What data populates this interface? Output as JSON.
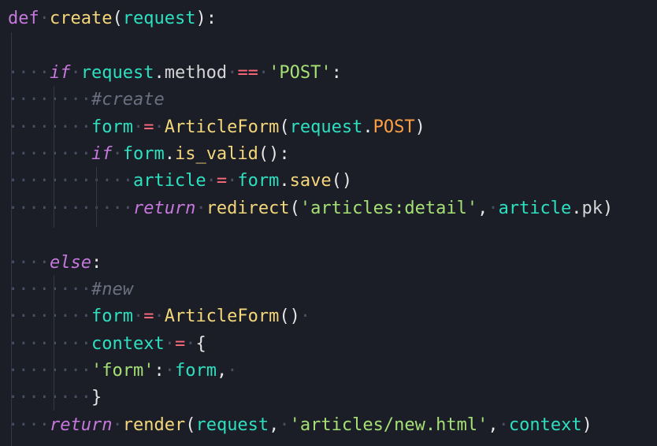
{
  "editor": {
    "theme": {
      "background": "#1b1d27",
      "whitespace": "#4a4f63",
      "default": "#d6d6d6",
      "keyword": "#c678dd",
      "keyword_italic": "#c678dd",
      "function": "#f3d77a",
      "variable": "#2ee0c0",
      "plain": "#d6d6d6",
      "operator": "#ff6b7a",
      "string": "#a5e075",
      "comment": "#6b7080",
      "constant": "#ff9f43",
      "punct": "#e6e6e6"
    },
    "lines": [
      [
        {
          "t": "def",
          "c": "keyword"
        },
        {
          "t": "·",
          "c": "ws"
        },
        {
          "t": "create",
          "c": "function"
        },
        {
          "t": "(",
          "c": "punct"
        },
        {
          "t": "request",
          "c": "variable"
        },
        {
          "t": "):",
          "c": "punct"
        }
      ],
      [],
      [
        {
          "t": "····",
          "c": "ws"
        },
        {
          "t": "if",
          "c": "keyword_italic"
        },
        {
          "t": "·",
          "c": "ws"
        },
        {
          "t": "request",
          "c": "variable"
        },
        {
          "t": ".",
          "c": "punct"
        },
        {
          "t": "method",
          "c": "plain"
        },
        {
          "t": "·",
          "c": "ws"
        },
        {
          "t": "==",
          "c": "operator"
        },
        {
          "t": "·",
          "c": "ws"
        },
        {
          "t": "'POST'",
          "c": "string"
        },
        {
          "t": ":",
          "c": "punct"
        }
      ],
      [
        {
          "t": "········",
          "c": "ws"
        },
        {
          "t": "#create",
          "c": "comment"
        }
      ],
      [
        {
          "t": "········",
          "c": "ws"
        },
        {
          "t": "form",
          "c": "variable"
        },
        {
          "t": "·",
          "c": "ws"
        },
        {
          "t": "=",
          "c": "operator"
        },
        {
          "t": "·",
          "c": "ws"
        },
        {
          "t": "ArticleForm",
          "c": "function"
        },
        {
          "t": "(",
          "c": "punct"
        },
        {
          "t": "request",
          "c": "variable"
        },
        {
          "t": ".",
          "c": "punct"
        },
        {
          "t": "POST",
          "c": "constant"
        },
        {
          "t": ")",
          "c": "punct"
        }
      ],
      [
        {
          "t": "········",
          "c": "ws"
        },
        {
          "t": "if",
          "c": "keyword_italic"
        },
        {
          "t": "·",
          "c": "ws"
        },
        {
          "t": "form",
          "c": "variable"
        },
        {
          "t": ".",
          "c": "punct"
        },
        {
          "t": "is_valid",
          "c": "function"
        },
        {
          "t": "():",
          "c": "punct"
        }
      ],
      [
        {
          "t": "············",
          "c": "ws"
        },
        {
          "t": "article",
          "c": "variable"
        },
        {
          "t": "·",
          "c": "ws"
        },
        {
          "t": "=",
          "c": "operator"
        },
        {
          "t": "·",
          "c": "ws"
        },
        {
          "t": "form",
          "c": "variable"
        },
        {
          "t": ".",
          "c": "punct"
        },
        {
          "t": "save",
          "c": "function"
        },
        {
          "t": "()",
          "c": "punct"
        }
      ],
      [
        {
          "t": "············",
          "c": "ws"
        },
        {
          "t": "return",
          "c": "keyword_italic"
        },
        {
          "t": "·",
          "c": "ws"
        },
        {
          "t": "redirect",
          "c": "function"
        },
        {
          "t": "(",
          "c": "punct"
        },
        {
          "t": "'articles:detail'",
          "c": "string"
        },
        {
          "t": ",",
          "c": "punct"
        },
        {
          "t": "·",
          "c": "ws"
        },
        {
          "t": "article",
          "c": "variable"
        },
        {
          "t": ".",
          "c": "punct"
        },
        {
          "t": "pk",
          "c": "plain"
        },
        {
          "t": ")",
          "c": "punct"
        }
      ],
      [],
      [
        {
          "t": "····",
          "c": "ws"
        },
        {
          "t": "else",
          "c": "keyword_italic"
        },
        {
          "t": ":",
          "c": "punct"
        }
      ],
      [
        {
          "t": "········",
          "c": "ws"
        },
        {
          "t": "#new",
          "c": "comment"
        }
      ],
      [
        {
          "t": "········",
          "c": "ws"
        },
        {
          "t": "form",
          "c": "variable"
        },
        {
          "t": "·",
          "c": "ws"
        },
        {
          "t": "=",
          "c": "operator"
        },
        {
          "t": "·",
          "c": "ws"
        },
        {
          "t": "ArticleForm",
          "c": "function"
        },
        {
          "t": "()",
          "c": "punct"
        },
        {
          "t": "·",
          "c": "ws"
        }
      ],
      [
        {
          "t": "········",
          "c": "ws"
        },
        {
          "t": "context",
          "c": "variable"
        },
        {
          "t": "·",
          "c": "ws"
        },
        {
          "t": "=",
          "c": "operator"
        },
        {
          "t": "·",
          "c": "ws"
        },
        {
          "t": "{",
          "c": "punct"
        }
      ],
      [
        {
          "t": "········",
          "c": "ws"
        },
        {
          "t": "'form'",
          "c": "string"
        },
        {
          "t": ":",
          "c": "punct"
        },
        {
          "t": "·",
          "c": "ws"
        },
        {
          "t": "form",
          "c": "variable"
        },
        {
          "t": ",",
          "c": "punct"
        },
        {
          "t": "·",
          "c": "ws"
        }
      ],
      [
        {
          "t": "········",
          "c": "ws"
        },
        {
          "t": "}",
          "c": "punct"
        }
      ],
      [
        {
          "t": "····",
          "c": "ws"
        },
        {
          "t": "return",
          "c": "keyword_italic"
        },
        {
          "t": "·",
          "c": "ws"
        },
        {
          "t": "render",
          "c": "function"
        },
        {
          "t": "(",
          "c": "punct"
        },
        {
          "t": "request",
          "c": "variable"
        },
        {
          "t": ",",
          "c": "punct"
        },
        {
          "t": "·",
          "c": "ws"
        },
        {
          "t": "'articles/new.html'",
          "c": "string"
        },
        {
          "t": ",",
          "c": "punct"
        },
        {
          "t": "·",
          "c": "ws"
        },
        {
          "t": "context",
          "c": "variable"
        },
        {
          "t": ")",
          "c": "punct"
        }
      ]
    ]
  }
}
